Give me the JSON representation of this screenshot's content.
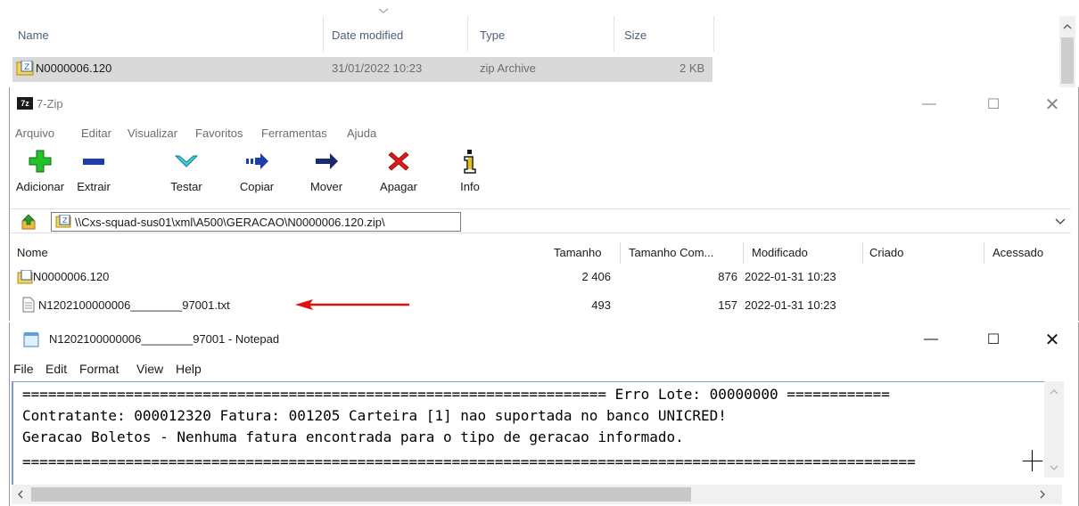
{
  "explorer": {
    "columns": [
      "Name",
      "Date modified",
      "Type",
      "Size"
    ],
    "file": {
      "name": "N0000006.120",
      "date": "31/01/2022 10:23",
      "type": "zip Archive",
      "size": "2 KB"
    }
  },
  "sevenzip": {
    "title": "7-Zip",
    "menu": [
      "Arquivo",
      "Editar",
      "Visualizar",
      "Favoritos",
      "Ferramentas",
      "Ajuda"
    ],
    "toolbar": {
      "add": "Adicionar",
      "extract": "Extrair",
      "test": "Testar",
      "copy": "Copiar",
      "move": "Mover",
      "delete": "Apagar",
      "info": "Info"
    },
    "address": "\\\\Cxs-squad-sus01\\xml\\A500\\GERACAO\\N0000006.120.zip\\",
    "columns": {
      "name": "Nome",
      "size": "Tamanho",
      "packed": "Tamanho Com...",
      "modified": "Modificado",
      "created": "Criado",
      "accessed": "Acessado"
    },
    "rows": [
      {
        "name": "N0000006.120",
        "size": "2 406",
        "packed": "876",
        "modified": "2022-01-31 10:23"
      },
      {
        "name": "N1202100000006________97001.txt",
        "size": "493",
        "packed": "157",
        "modified": "2022-01-31 10:23"
      }
    ],
    "colors": {
      "arrow": "#e01010"
    }
  },
  "notepad": {
    "title": "N1202100000006________97001 - Notepad",
    "menu": [
      "File",
      "Edit",
      "Format",
      "View",
      "Help"
    ],
    "lines": [
      "==================================================================== Erro Lote: 00000000 ============",
      "Contratante: 000012320 Fatura: 001205 Carteira [1] nao suportada no banco UNICRED!",
      "Geracao Boletos - Nenhuma fatura encontrada para o tipo de geracao informado.",
      "========================================================================================================"
    ]
  }
}
